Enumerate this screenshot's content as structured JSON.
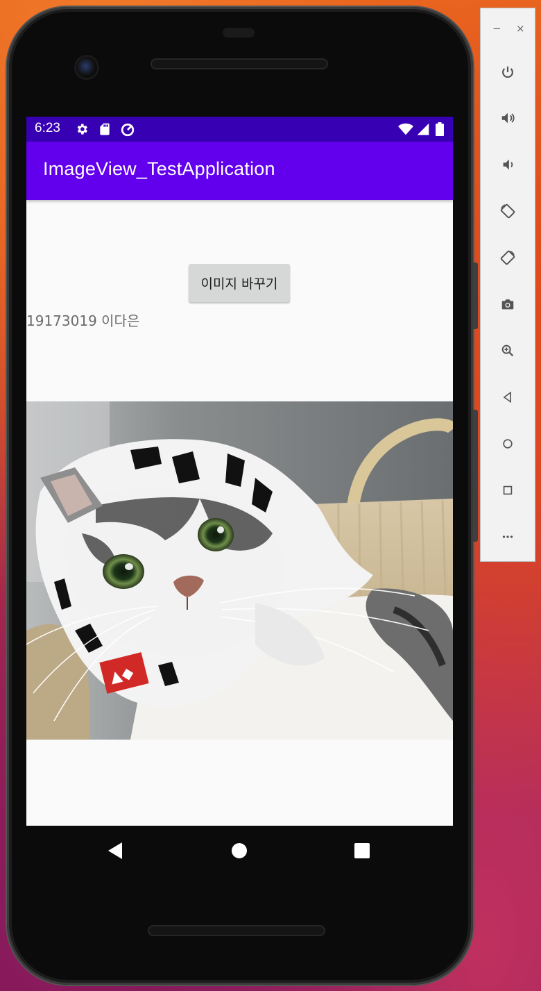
{
  "status_bar": {
    "time": "6:23",
    "left_icons": [
      "settings-icon",
      "sd-card-icon",
      "data-saver-icon"
    ],
    "right_icons": [
      "wifi-icon",
      "cell-signal-icon",
      "battery-icon"
    ]
  },
  "app_bar": {
    "title": "ImageView_TestApplication"
  },
  "content": {
    "change_button_label": "이미지 바꾸기",
    "student_text": "19173019 이다은",
    "image_subject": "cat wearing white patterned headscarf lying in wicker basket"
  },
  "nav_bar": {
    "buttons": [
      "back",
      "home",
      "recents"
    ]
  },
  "emulator_panel": {
    "minimize_label": "−",
    "close_label": "×",
    "buttons": [
      "power",
      "volume-up",
      "volume-down",
      "rotate-left",
      "rotate-right",
      "screenshot",
      "zoom",
      "back",
      "home",
      "overview",
      "more"
    ]
  },
  "colors": {
    "status_bar": "#3700b3",
    "app_bar": "#6200ee",
    "screen_background": "#fafafa",
    "button_background": "#d6d7d7"
  }
}
